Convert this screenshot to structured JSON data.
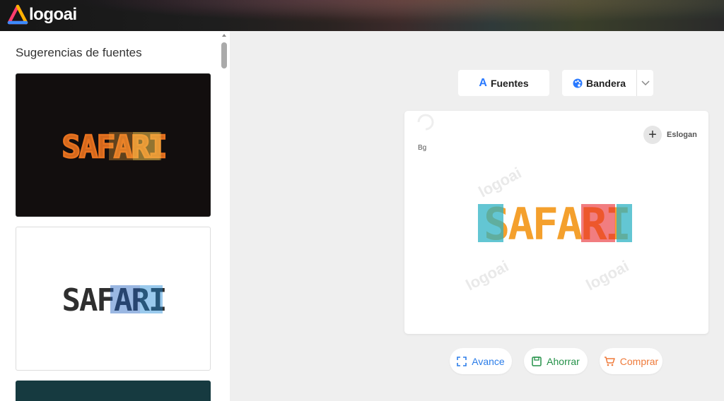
{
  "app": {
    "brand_name": "logoai"
  },
  "sidebar": {
    "title": "Sugerencias de fuentes",
    "cards": [
      {
        "text": "SAFARI",
        "background": "#120e0e",
        "colors": [
          "#e8721f",
          "#f2a33a",
          "#f3d05a"
        ]
      },
      {
        "text": "SAFARI",
        "background": "#ffffff",
        "colors": [
          "#2f2f2f",
          "#1f5fbf",
          "#1e8ad6"
        ]
      },
      {
        "text": "",
        "background": "#163a40"
      }
    ]
  },
  "toolbar": {
    "fuentes_label": "Fuentes",
    "bandera_label": "Bandera",
    "fuentes_glyph": "A"
  },
  "canvas": {
    "bg_label": "Bg",
    "slogan_label": "Eslogan",
    "logo_text": "SAFARI",
    "logo_colors": [
      "#2fb3c4",
      "#f4a02d",
      "#e8262b"
    ],
    "watermark": "logoai"
  },
  "actions": {
    "avance_label": "Avance",
    "ahorrar_label": "Ahorrar",
    "comprar_label": "Comprar"
  },
  "colors": {
    "accent_blue": "#2979ff",
    "avance": "#2b7de9",
    "ahorrar": "#249148",
    "comprar": "#ef7a3a"
  }
}
